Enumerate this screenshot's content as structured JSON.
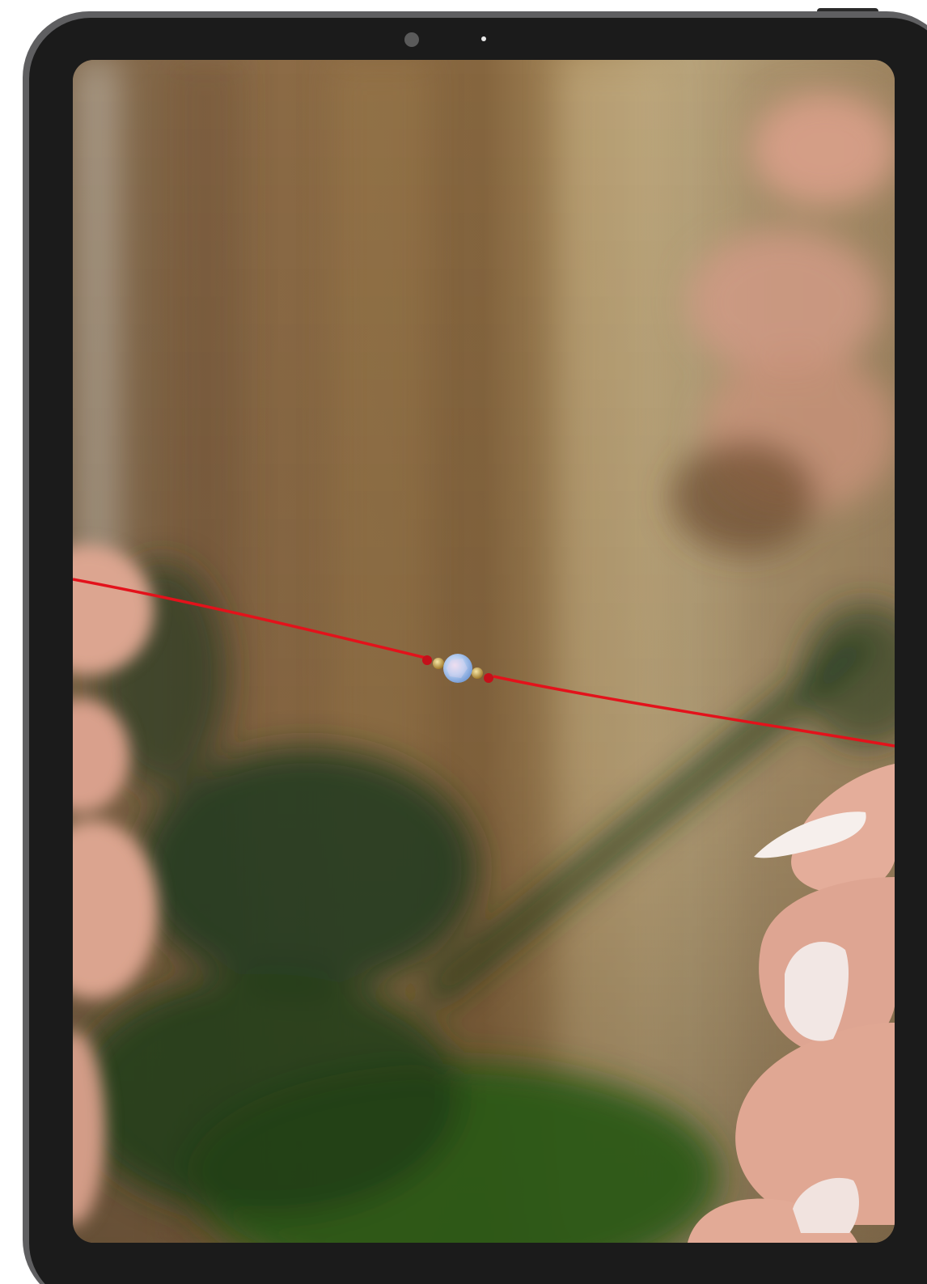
{
  "device": {
    "type": "tablet",
    "frame_color": "#5f5f61",
    "bezel_color": "#1b1b1b"
  },
  "screen_content": {
    "kind": "photo",
    "subject": "red-string-bracelet-with-opal-bead",
    "colors": {
      "background_wood": "#8a6a45",
      "string_red": "#e3121b",
      "bead_blue": "#a9c6ee",
      "gold_bead": "#c9a24a",
      "plant_green": "#1f4a1c",
      "skin": "#e7b4a1"
    }
  }
}
